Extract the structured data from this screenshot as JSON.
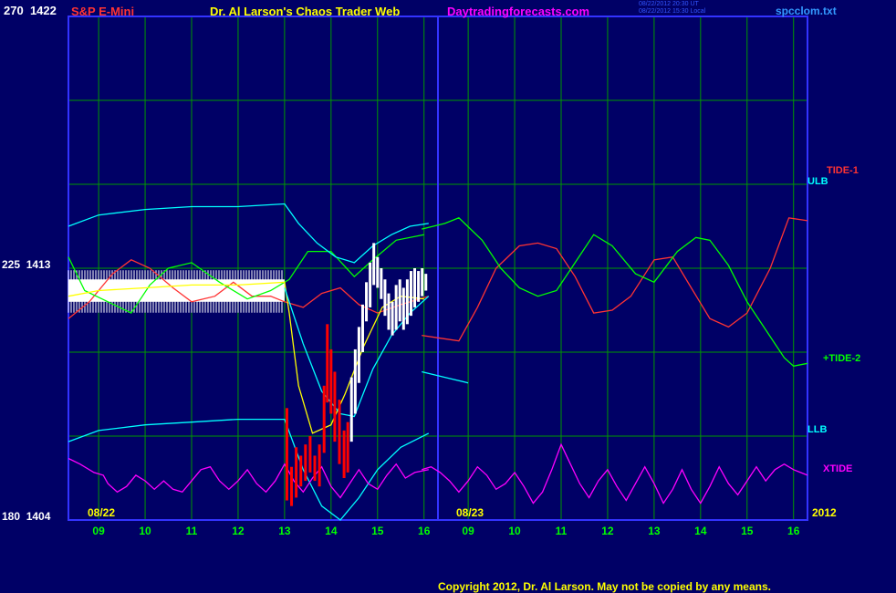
{
  "header": {
    "symbol": "S&P E-Mini",
    "author": "Dr. Al Larson's Chaos Trader Web",
    "site": "Daytradingforecasts.com",
    "stamp_line1": "08/22/2012 20:30 UT",
    "stamp_line2": "08/22/2012 15:30 Local",
    "filename": "spcclom.txt"
  },
  "footer": {
    "copyright": "Copyright 2012, Dr. Al Larson. May not be copied by any means."
  },
  "colors": {
    "background": "#000066",
    "grid": "#009900",
    "axis": "#3333ff"
  },
  "chart_data": {
    "type": "line",
    "x_unit": "hour",
    "x_range": [
      8.35,
      16.3
    ],
    "y_range": [
      1404,
      1422
    ],
    "y_alt_range": [
      180,
      270
    ],
    "y_ticks": [
      {
        "price": "1422",
        "alt": "270"
      },
      {
        "price": "1413",
        "alt": "225"
      },
      {
        "price": "1404",
        "alt": "180"
      }
    ],
    "day_labels": [
      {
        "day": "08/22",
        "x": 8.35
      },
      {
        "day": "08/23",
        "x": 16.3
      }
    ],
    "year_label": "2012",
    "hour_ticks": [
      {
        "day": 0,
        "h": 9,
        "label": "09"
      },
      {
        "day": 0,
        "h": 10,
        "label": "10"
      },
      {
        "day": 0,
        "h": 11,
        "label": "11"
      },
      {
        "day": 0,
        "h": 12,
        "label": "12"
      },
      {
        "day": 0,
        "h": 13,
        "label": "13"
      },
      {
        "day": 0,
        "h": 14,
        "label": "14"
      },
      {
        "day": 0,
        "h": 15,
        "label": "15"
      },
      {
        "day": 0,
        "h": 16,
        "label": "16"
      },
      {
        "day": 1,
        "h": 9,
        "label": "09"
      },
      {
        "day": 1,
        "h": 10,
        "label": "10"
      },
      {
        "day": 1,
        "h": 11,
        "label": "11"
      },
      {
        "day": 1,
        "h": 12,
        "label": "12"
      },
      {
        "day": 1,
        "h": 13,
        "label": "13"
      },
      {
        "day": 1,
        "h": 14,
        "label": "14"
      },
      {
        "day": 1,
        "h": 15,
        "label": "15"
      },
      {
        "day": 1,
        "h": 16,
        "label": "16"
      }
    ],
    "series_labels": [
      {
        "name": "TIDE-1",
        "color": "#ff3333"
      },
      {
        "name": "ULB",
        "color": "#00ffff"
      },
      {
        "name": "+TIDE-2",
        "color": "#00ff00"
      },
      {
        "name": "LLB",
        "color": "#00ffff"
      },
      {
        "name": "XTIDE",
        "color": "#ff00ff"
      }
    ],
    "series": [
      {
        "color": "#ff3333",
        "day": 0,
        "points": [
          [
            8.35,
            1411.2
          ],
          [
            8.8,
            1411.8
          ],
          [
            9.3,
            1412.8
          ],
          [
            9.7,
            1413.3
          ],
          [
            10.1,
            1413.0
          ],
          [
            10.6,
            1412.3
          ],
          [
            11.0,
            1411.8
          ],
          [
            11.5,
            1412.0
          ],
          [
            11.9,
            1412.5
          ],
          [
            12.3,
            1412.0
          ],
          [
            12.7,
            1412.0
          ],
          [
            13.0,
            1411.8
          ],
          [
            13.4,
            1411.6
          ],
          [
            13.8,
            1412.1
          ],
          [
            14.2,
            1412.3
          ],
          [
            14.6,
            1411.7
          ],
          [
            15.0,
            1411.4
          ],
          [
            15.5,
            1411.7
          ],
          [
            16.1,
            1412.0
          ]
        ]
      },
      {
        "color": "#ff3333",
        "day": 1,
        "points": [
          [
            8.0,
            1410.6
          ],
          [
            8.4,
            1410.5
          ],
          [
            8.8,
            1410.4
          ],
          [
            9.2,
            1411.6
          ],
          [
            9.6,
            1413.0
          ],
          [
            10.1,
            1413.8
          ],
          [
            10.5,
            1413.9
          ],
          [
            10.9,
            1413.7
          ],
          [
            11.3,
            1412.7
          ],
          [
            11.7,
            1411.4
          ],
          [
            12.1,
            1411.5
          ],
          [
            12.5,
            1412.0
          ],
          [
            13.0,
            1413.3
          ],
          [
            13.4,
            1413.4
          ],
          [
            13.8,
            1412.3
          ],
          [
            14.2,
            1411.2
          ],
          [
            14.6,
            1410.9
          ],
          [
            15.0,
            1411.4
          ],
          [
            15.5,
            1413.0
          ],
          [
            15.9,
            1414.8
          ],
          [
            16.3,
            1414.7
          ]
        ]
      },
      {
        "color": "#00ff00",
        "day": 0,
        "points": [
          [
            8.35,
            1413.4
          ],
          [
            8.7,
            1412.2
          ],
          [
            9.2,
            1411.8
          ],
          [
            9.7,
            1411.4
          ],
          [
            10.1,
            1412.4
          ],
          [
            10.5,
            1413.0
          ],
          [
            11.0,
            1413.2
          ],
          [
            11.6,
            1412.5
          ],
          [
            12.2,
            1411.9
          ],
          [
            12.7,
            1412.2
          ],
          [
            13.1,
            1412.6
          ],
          [
            13.5,
            1413.6
          ],
          [
            14.0,
            1413.6
          ],
          [
            14.5,
            1412.7
          ],
          [
            14.9,
            1413.3
          ],
          [
            15.4,
            1414.0
          ],
          [
            16.0,
            1414.2
          ]
        ]
      },
      {
        "color": "#00ff00",
        "day": 1,
        "points": [
          [
            8.0,
            1414.4
          ],
          [
            8.5,
            1414.6
          ],
          [
            8.8,
            1414.8
          ],
          [
            9.3,
            1414.0
          ],
          [
            9.7,
            1413.0
          ],
          [
            10.1,
            1412.3
          ],
          [
            10.5,
            1412.0
          ],
          [
            10.9,
            1412.2
          ],
          [
            11.3,
            1413.2
          ],
          [
            11.7,
            1414.2
          ],
          [
            12.1,
            1413.8
          ],
          [
            12.6,
            1412.8
          ],
          [
            13.0,
            1412.5
          ],
          [
            13.5,
            1413.6
          ],
          [
            13.9,
            1414.1
          ],
          [
            14.2,
            1414.0
          ],
          [
            14.6,
            1413.1
          ],
          [
            15.0,
            1411.8
          ],
          [
            15.4,
            1410.8
          ],
          [
            15.8,
            1409.8
          ],
          [
            16.0,
            1409.5
          ],
          [
            16.3,
            1409.6
          ]
        ]
      },
      {
        "color": "#00ffff",
        "day": 0,
        "points": [
          [
            8.35,
            1414.5
          ],
          [
            9.0,
            1414.9
          ],
          [
            10.0,
            1415.1
          ],
          [
            11.0,
            1415.2
          ],
          [
            12.0,
            1415.2
          ],
          [
            13.0,
            1415.3
          ],
          [
            13.3,
            1414.6
          ],
          [
            13.7,
            1413.9
          ],
          [
            14.1,
            1413.4
          ],
          [
            14.5,
            1413.2
          ],
          [
            14.9,
            1413.8
          ],
          [
            15.3,
            1414.2
          ],
          [
            15.7,
            1414.5
          ],
          [
            16.1,
            1414.6
          ]
        ]
      },
      {
        "color": "#00ffff",
        "day": 0,
        "points": [
          [
            8.35,
            1406.8
          ],
          [
            9.0,
            1407.2
          ],
          [
            10.0,
            1407.4
          ],
          [
            11.0,
            1407.5
          ],
          [
            12.0,
            1407.6
          ],
          [
            13.0,
            1407.6
          ],
          [
            13.4,
            1405.8
          ],
          [
            13.8,
            1404.5
          ],
          [
            14.2,
            1404.0
          ],
          [
            14.6,
            1404.8
          ],
          [
            15.0,
            1405.8
          ],
          [
            15.5,
            1406.6
          ],
          [
            16.1,
            1407.1
          ]
        ]
      },
      {
        "color": "#ffff00",
        "day": 0,
        "points": [
          [
            8.35,
            1412.0
          ],
          [
            9.0,
            1412.2
          ],
          [
            10.0,
            1412.3
          ],
          [
            11.0,
            1412.4
          ],
          [
            12.0,
            1412.4
          ],
          [
            13.0,
            1412.5
          ],
          [
            13.1,
            1411.4
          ],
          [
            13.3,
            1408.8
          ],
          [
            13.6,
            1407.1
          ],
          [
            14.0,
            1407.4
          ],
          [
            14.3,
            1408.5
          ],
          [
            14.7,
            1410.2
          ],
          [
            15.1,
            1411.6
          ],
          [
            15.5,
            1412.0
          ],
          [
            16.0,
            1411.9
          ]
        ]
      },
      {
        "color": "#00ffff",
        "day": 0,
        "points": [
          [
            13.0,
            1412.3
          ],
          [
            13.4,
            1410.3
          ],
          [
            13.8,
            1408.6
          ],
          [
            14.2,
            1407.8
          ],
          [
            14.5,
            1407.7
          ],
          [
            14.9,
            1409.4
          ],
          [
            15.3,
            1410.6
          ],
          [
            15.7,
            1411.4
          ],
          [
            16.1,
            1412.0
          ]
        ]
      },
      {
        "color": "#ff00ff",
        "day": 0,
        "points": [
          [
            8.35,
            1406.2
          ],
          [
            8.6,
            1406.0
          ],
          [
            8.9,
            1405.7
          ],
          [
            9.1,
            1405.6
          ],
          [
            9.2,
            1405.3
          ],
          [
            9.4,
            1405.0
          ],
          [
            9.6,
            1405.2
          ],
          [
            9.8,
            1405.6
          ],
          [
            10.0,
            1405.4
          ],
          [
            10.2,
            1405.1
          ],
          [
            10.4,
            1405.4
          ],
          [
            10.6,
            1405.1
          ],
          [
            10.8,
            1405.0
          ],
          [
            11.0,
            1405.4
          ],
          [
            11.2,
            1405.8
          ],
          [
            11.4,
            1405.9
          ],
          [
            11.6,
            1405.4
          ],
          [
            11.8,
            1405.1
          ],
          [
            12.0,
            1405.4
          ],
          [
            12.2,
            1405.8
          ],
          [
            12.4,
            1405.3
          ],
          [
            12.6,
            1405.0
          ],
          [
            12.8,
            1405.4
          ],
          [
            13.0,
            1406.0
          ],
          [
            13.2,
            1405.4
          ],
          [
            13.4,
            1405.0
          ],
          [
            13.6,
            1405.5
          ],
          [
            13.8,
            1405.9
          ],
          [
            14.0,
            1405.2
          ],
          [
            14.2,
            1404.8
          ],
          [
            14.4,
            1405.3
          ],
          [
            14.6,
            1405.8
          ],
          [
            14.8,
            1405.3
          ],
          [
            15.0,
            1405.1
          ],
          [
            15.2,
            1405.6
          ],
          [
            15.4,
            1406.0
          ],
          [
            15.6,
            1405.5
          ],
          [
            15.8,
            1405.7
          ],
          [
            16.1,
            1405.8
          ]
        ]
      },
      {
        "color": "#ff00ff",
        "day": 1,
        "points": [
          [
            8.0,
            1405.8
          ],
          [
            8.2,
            1405.9
          ],
          [
            8.4,
            1405.7
          ],
          [
            8.6,
            1405.4
          ],
          [
            8.8,
            1405.0
          ],
          [
            9.0,
            1405.4
          ],
          [
            9.2,
            1405.9
          ],
          [
            9.4,
            1405.6
          ],
          [
            9.6,
            1405.1
          ],
          [
            9.8,
            1405.3
          ],
          [
            10.0,
            1405.7
          ],
          [
            10.2,
            1405.2
          ],
          [
            10.4,
            1404.6
          ],
          [
            10.6,
            1405.0
          ],
          [
            10.8,
            1405.8
          ],
          [
            11.0,
            1406.7
          ],
          [
            11.2,
            1406.0
          ],
          [
            11.4,
            1405.3
          ],
          [
            11.6,
            1404.8
          ],
          [
            11.8,
            1405.4
          ],
          [
            12.0,
            1405.8
          ],
          [
            12.2,
            1405.2
          ],
          [
            12.4,
            1404.7
          ],
          [
            12.6,
            1405.3
          ],
          [
            12.8,
            1405.9
          ],
          [
            13.0,
            1405.3
          ],
          [
            13.2,
            1404.6
          ],
          [
            13.4,
            1405.1
          ],
          [
            13.6,
            1405.8
          ],
          [
            13.8,
            1405.1
          ],
          [
            14.0,
            1404.6
          ],
          [
            14.2,
            1405.2
          ],
          [
            14.4,
            1405.9
          ],
          [
            14.6,
            1405.3
          ],
          [
            14.8,
            1404.9
          ],
          [
            15.0,
            1405.4
          ],
          [
            15.2,
            1405.9
          ],
          [
            15.4,
            1405.4
          ],
          [
            15.6,
            1405.8
          ],
          [
            15.8,
            1406.0
          ],
          [
            16.0,
            1405.8
          ],
          [
            16.3,
            1405.6
          ]
        ]
      }
    ],
    "lower_band_day1": [
      [
        8.0,
        1409.3
      ],
      [
        8.5,
        1409.1
      ],
      [
        9.0,
        1408.9
      ]
    ],
    "band": {
      "color": "#ffffff",
      "x0": 8.35,
      "x1": 13.0,
      "y0": 1411.8,
      "y1": 1412.6
    },
    "price_bars_red": [
      {
        "x": 13.05,
        "lo": 1404.7,
        "hi": 1408.0
      },
      {
        "x": 13.15,
        "lo": 1404.5,
        "hi": 1405.9
      },
      {
        "x": 13.25,
        "lo": 1404.8,
        "hi": 1406.6
      },
      {
        "x": 13.35,
        "lo": 1405.2,
        "hi": 1406.3
      },
      {
        "x": 13.45,
        "lo": 1405.4,
        "hi": 1406.7
      },
      {
        "x": 13.55,
        "lo": 1405.7,
        "hi": 1407.0
      },
      {
        "x": 13.65,
        "lo": 1405.4,
        "hi": 1406.3
      },
      {
        "x": 13.75,
        "lo": 1405.2,
        "hi": 1406.7
      },
      {
        "x": 13.85,
        "lo": 1406.4,
        "hi": 1408.8
      },
      {
        "x": 13.92,
        "lo": 1408.2,
        "hi": 1411.0
      },
      {
        "x": 14.0,
        "lo": 1407.8,
        "hi": 1410.1
      },
      {
        "x": 14.08,
        "lo": 1406.8,
        "hi": 1409.3
      },
      {
        "x": 14.18,
        "lo": 1406.0,
        "hi": 1408.3
      },
      {
        "x": 14.28,
        "lo": 1405.5,
        "hi": 1407.2
      },
      {
        "x": 14.36,
        "lo": 1405.7,
        "hi": 1407.5
      }
    ],
    "price_bars_white": [
      {
        "x": 14.44,
        "lo": 1406.8,
        "hi": 1409.1
      },
      {
        "x": 14.52,
        "lo": 1407.8,
        "hi": 1410.1
      },
      {
        "x": 14.6,
        "lo": 1408.9,
        "hi": 1410.9
      },
      {
        "x": 14.68,
        "lo": 1410.0,
        "hi": 1411.7
      },
      {
        "x": 14.76,
        "lo": 1411.1,
        "hi": 1412.5
      },
      {
        "x": 14.84,
        "lo": 1411.6,
        "hi": 1413.2
      },
      {
        "x": 14.92,
        "lo": 1412.4,
        "hi": 1413.9
      },
      {
        "x": 15.0,
        "lo": 1412.3,
        "hi": 1413.4
      },
      {
        "x": 15.08,
        "lo": 1411.9,
        "hi": 1413.0
      },
      {
        "x": 15.16,
        "lo": 1411.3,
        "hi": 1412.6
      },
      {
        "x": 15.24,
        "lo": 1410.8,
        "hi": 1412.1
      },
      {
        "x": 15.32,
        "lo": 1410.6,
        "hi": 1411.8
      },
      {
        "x": 15.4,
        "lo": 1410.8,
        "hi": 1412.4
      },
      {
        "x": 15.48,
        "lo": 1411.1,
        "hi": 1412.6
      },
      {
        "x": 15.56,
        "lo": 1410.8,
        "hi": 1412.3
      },
      {
        "x": 15.64,
        "lo": 1411.0,
        "hi": 1412.6
      },
      {
        "x": 15.72,
        "lo": 1411.3,
        "hi": 1412.9
      },
      {
        "x": 15.8,
        "lo": 1411.6,
        "hi": 1413.0
      },
      {
        "x": 15.88,
        "lo": 1411.8,
        "hi": 1412.9
      },
      {
        "x": 15.96,
        "lo": 1412.0,
        "hi": 1413.0
      },
      {
        "x": 16.04,
        "lo": 1412.2,
        "hi": 1412.8
      }
    ]
  }
}
